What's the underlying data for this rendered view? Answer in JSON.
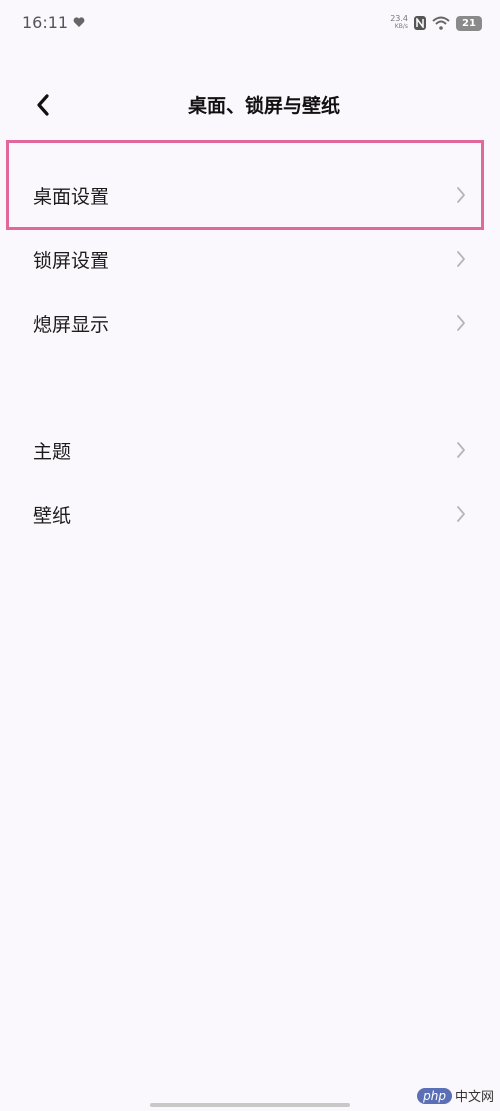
{
  "status_bar": {
    "time": "16:11",
    "net_speed_value": "23.4",
    "net_speed_unit": "KB/s",
    "battery": "21",
    "icons": [
      "heart-icon",
      "nfc-icon",
      "wifi-icon",
      "battery-icon"
    ]
  },
  "header": {
    "title": "桌面、锁屏与壁纸",
    "back_icon": "chevron-left-icon"
  },
  "section_1": {
    "items": [
      {
        "label": "桌面设置",
        "highlighted": true
      },
      {
        "label": "锁屏设置"
      },
      {
        "label": "熄屏显示"
      }
    ]
  },
  "section_2": {
    "items": [
      {
        "label": "主题"
      },
      {
        "label": "壁纸"
      }
    ]
  },
  "watermark": {
    "badge": "php",
    "text": "中文网"
  },
  "colors": {
    "background": "#fbf8fd",
    "highlight_border": "#e0689a",
    "chevron": "#b5b5b5"
  }
}
